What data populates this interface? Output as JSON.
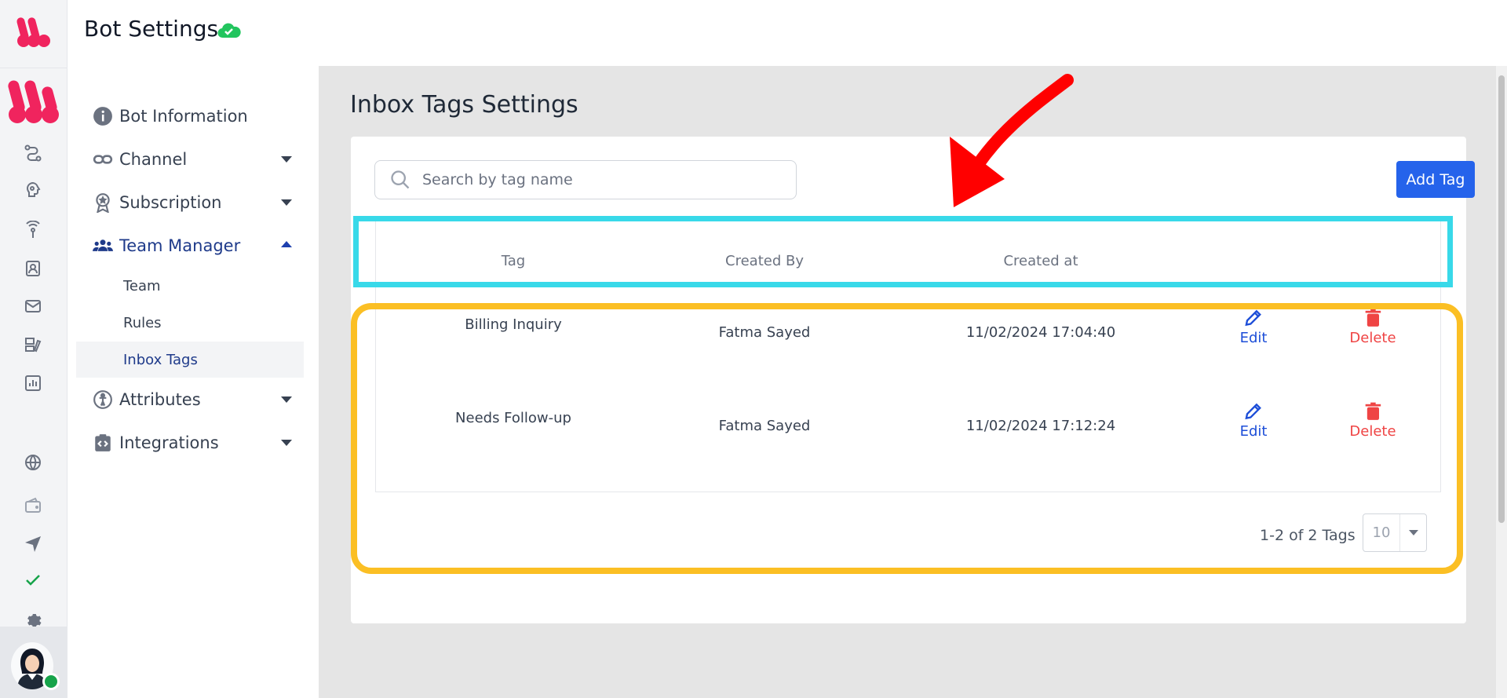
{
  "header": {
    "title": "Bot Settings"
  },
  "sidebar": {
    "items": [
      {
        "label": "Bot Information",
        "icon": "info-icon",
        "has_caret": false
      },
      {
        "label": "Channel",
        "icon": "link-icon",
        "has_caret": true
      },
      {
        "label": "Subscription",
        "icon": "award-icon",
        "has_caret": true
      },
      {
        "label": "Team Manager",
        "icon": "users-icon",
        "has_caret": true,
        "expanded": true
      },
      {
        "label": "Attributes",
        "icon": "person-circle-icon",
        "has_caret": true
      },
      {
        "label": "Integrations",
        "icon": "code-clipboard-icon",
        "has_caret": true
      }
    ],
    "sub_items": [
      {
        "label": "Team"
      },
      {
        "label": "Rules"
      },
      {
        "label": "Inbox Tags",
        "active": true
      }
    ]
  },
  "main": {
    "title": "Inbox Tags Settings",
    "search": {
      "placeholder": "Search by tag name",
      "value": ""
    },
    "add_button": "Add Tag",
    "table": {
      "columns": [
        "Tag",
        "Created By",
        "Created at"
      ],
      "rows": [
        {
          "tag": "Billing Inquiry",
          "created_by": "Fatma Sayed",
          "created_at": "11/02/2024 17:04:40",
          "edit": "Edit",
          "delete": "Delete"
        },
        {
          "tag": "Needs Follow-up",
          "created_by": "Fatma Sayed",
          "created_at": "11/02/2024 17:12:24",
          "edit": "Edit",
          "delete": "Delete"
        }
      ]
    },
    "pagination": {
      "summary": "1-2 of 2 Tags",
      "page_size": "10"
    }
  },
  "colors": {
    "accent_blue": "#2563eb",
    "brand_pink": "#f0245e",
    "delete_red": "#ef4444",
    "annotation_cyan": "#38d9e9",
    "annotation_yellow": "#fbbf24",
    "annotation_arrow": "#ff0000",
    "status_green": "#16a34a"
  }
}
